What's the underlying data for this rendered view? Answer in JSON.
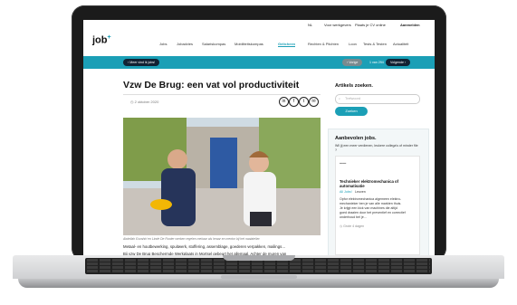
{
  "topbar": {
    "lang": "NL",
    "links": [
      "Voor werkgevers",
      "Plaats je CV online",
      "Aanmelden"
    ]
  },
  "logo": {
    "text": "job",
    "plus": "+"
  },
  "nav": [
    "Jobs",
    "Jobadvies",
    "Salariskompas",
    "Mobiliteitskompas",
    "Gelicheen",
    "Rechten & Plichten",
    "Loon",
    "Tests & Testen",
    "Actualiteit"
  ],
  "nav_active_index": 4,
  "band": {
    "back": "‹  Meer vind ik jobs!",
    "prev": "‹ Vorige",
    "count": "1 van 294",
    "next": "Volgende ›"
  },
  "article": {
    "title": "Vzw De Brug: een vat vol productiviteit",
    "date": "2 oktober 2020",
    "share_icons": [
      "in",
      "f",
      "t",
      "✉"
    ],
    "caption": "Abdellah Ezzahiri en Linde De Rooter werken regelen mekaar als leraar en mentor bij het naaiatelier.",
    "line1": "Metaal- en houtbewerking, spuitwerk, stoffering, assemblage, goederen verpakken, mailings…",
    "line2": "Bij vzw De Brug Beschermde Werkplaats in Mortsel gebeurt het allemaal. Achter de muren van"
  },
  "sidebar": {
    "search_title": "Artikels zoeken.",
    "search_placeholder": "Trefwoord",
    "search_button": "Zoeken",
    "jobs_title": "Aanbevolen jobs.",
    "jobs_intro": "Wil jij een meer verdienen, leukere collega's of minder file ?",
    "job_title": "Technieker elektromechanica of automatisatie",
    "job_company": "All Jobs!",
    "job_location": "Leuven",
    "job_desc1": "Opfor elektromechanica algemeen elektro-",
    "job_desc2": "mechanieker ben je van alle markten thuis.",
    "job_desc3": "Je krijgt een kick van machines die altijd",
    "job_desc4": "goed draaien door het preventief en correctief",
    "job_desc5": "onderhoud bel je…",
    "job_age": "Grote 4 dagen"
  }
}
